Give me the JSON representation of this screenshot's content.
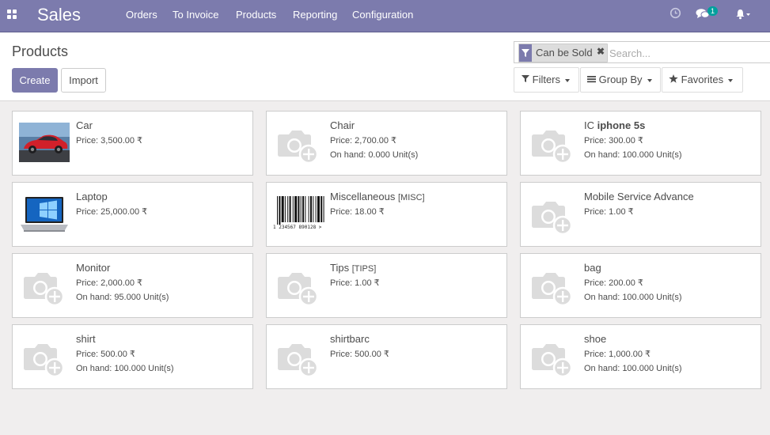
{
  "app": {
    "brand": "Sales"
  },
  "nav": {
    "menus": [
      "Orders",
      "To Invoice",
      "Products",
      "Reporting",
      "Configuration"
    ],
    "messages_count": "1"
  },
  "control": {
    "breadcrumb": "Products",
    "create_label": "Create",
    "import_label": "Import",
    "facet_label": "Can be Sold",
    "search_placeholder": "Search...",
    "filters_label": "Filters",
    "groupby_label": "Group By",
    "favorites_label": "Favorites"
  },
  "products": [
    {
      "name": "Car",
      "code": "",
      "price": "Price: 3,500.00 ₹",
      "on_hand": "",
      "image": "car"
    },
    {
      "name": "Chair",
      "code": "",
      "price": "Price: 2,700.00 ₹",
      "on_hand": "On hand: 0.000 Unit(s)",
      "image": "placeholder"
    },
    {
      "name_prefix": "IC ",
      "name_bold": "iphone 5s",
      "code": "",
      "price": "Price: 300.00 ₹",
      "on_hand": "On hand: 100.000 Unit(s)",
      "image": "placeholder"
    },
    {
      "name": "Laptop",
      "code": "",
      "price": "Price: 25,000.00 ₹",
      "on_hand": "",
      "image": "laptop"
    },
    {
      "name": "Miscellaneous",
      "code": "[MISC]",
      "price": "Price: 18.00 ₹",
      "on_hand": "",
      "image": "barcode",
      "barcode_text": "1 234567 890128 >"
    },
    {
      "name": "Mobile Service Advance",
      "code": "",
      "price": "Price: 1.00 ₹",
      "on_hand": "",
      "image": "placeholder"
    },
    {
      "name": "Monitor",
      "code": "",
      "price": "Price: 2,000.00 ₹",
      "on_hand": "On hand: 95.000 Unit(s)",
      "image": "placeholder"
    },
    {
      "name": "Tips",
      "code": "[TIPS]",
      "price": "Price: 1.00 ₹",
      "on_hand": "",
      "image": "placeholder"
    },
    {
      "name": "bag",
      "code": "",
      "price": "Price: 200.00 ₹",
      "on_hand": "On hand: 100.000 Unit(s)",
      "image": "placeholder"
    },
    {
      "name": "shirt",
      "code": "",
      "price": "Price: 500.00 ₹",
      "on_hand": "On hand: 100.000 Unit(s)",
      "image": "placeholder"
    },
    {
      "name": "shirtbarc",
      "code": "",
      "price": "Price: 500.00 ₹",
      "on_hand": "",
      "image": "placeholder"
    },
    {
      "name": "shoe",
      "code": "",
      "price": "Price: 1,000.00 ₹",
      "on_hand": "On hand: 100.000 Unit(s)",
      "image": "placeholder"
    }
  ],
  "colors": {
    "brand": "#7c7bad",
    "badge": "#00a09d",
    "background": "#f0eeee"
  },
  "icons": [
    "apps-icon",
    "clock-icon",
    "chat-icon",
    "bell-icon",
    "filter-icon",
    "list-icon",
    "star-icon",
    "camera-placeholder-icon"
  ]
}
